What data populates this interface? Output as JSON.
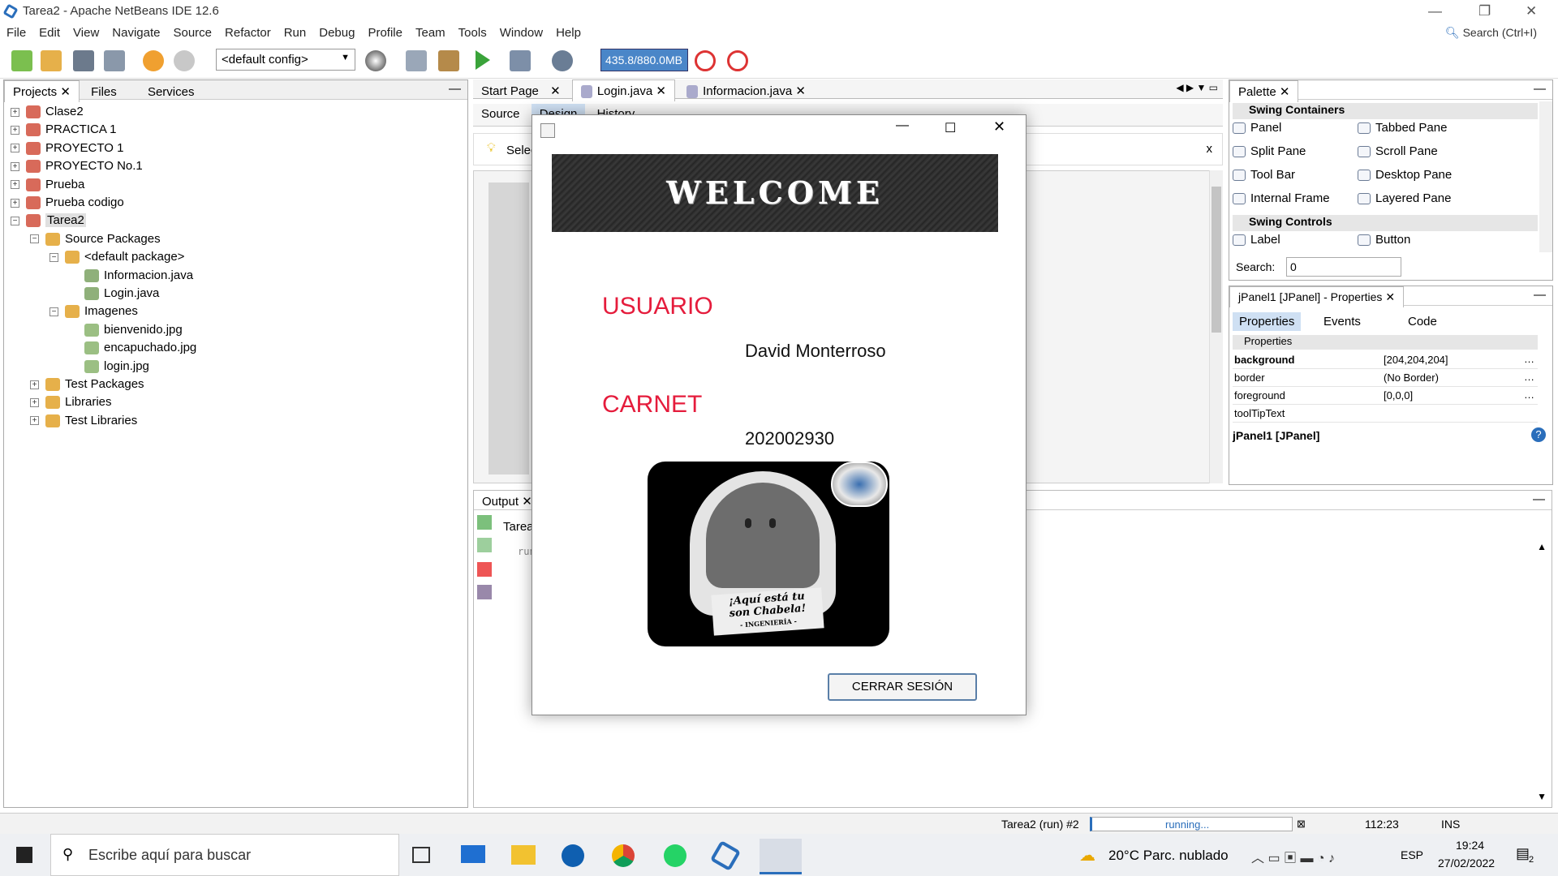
{
  "window": {
    "title": "Tarea2 - Apache NetBeans IDE 12.6",
    "search_placeholder": "Search (Ctrl+I)"
  },
  "menu": [
    "File",
    "Edit",
    "View",
    "Navigate",
    "Source",
    "Refactor",
    "Run",
    "Debug",
    "Profile",
    "Team",
    "Tools",
    "Window",
    "Help"
  ],
  "toolbar": {
    "config": "<default config>",
    "memory": "435.8/880.0MB"
  },
  "left_tabs": [
    "Projects",
    "Files",
    "Services"
  ],
  "tree": [
    {
      "label": "Clase2",
      "depth": 0
    },
    {
      "label": "PRACTICA 1",
      "depth": 0
    },
    {
      "label": "PROYECTO 1",
      "depth": 0
    },
    {
      "label": "PROYECTO No.1",
      "depth": 0
    },
    {
      "label": "Prueba",
      "depth": 0
    },
    {
      "label": "Prueba codigo",
      "depth": 0
    },
    {
      "label": "Tarea2",
      "depth": 0
    },
    {
      "label": "Source Packages",
      "depth": 1
    },
    {
      "label": "<default package>",
      "depth": 2
    },
    {
      "label": "Informacion.java",
      "depth": 3
    },
    {
      "label": "Login.java",
      "depth": 3
    },
    {
      "label": "Imagenes",
      "depth": 2
    },
    {
      "label": "bienvenido.jpg",
      "depth": 3
    },
    {
      "label": "encapuchado.jpg",
      "depth": 3
    },
    {
      "label": "login.jpg",
      "depth": 3
    },
    {
      "label": "Test Packages",
      "depth": 1
    },
    {
      "label": "Libraries",
      "depth": 1
    },
    {
      "label": "Test Libraries",
      "depth": 1
    }
  ],
  "editor_tabs": [
    "Start Page",
    "Login.java",
    "Informacion.java"
  ],
  "editor_subtabs": {
    "source": "Source",
    "design": "Design",
    "history": "History",
    "select": "Selec"
  },
  "output": {
    "tab": "Output",
    "subtab": "Tarea",
    "run_text": "run"
  },
  "dialog": {
    "welcome": "WELCOME",
    "usuario_label": "USUARIO",
    "usuario_value": "David Monterroso",
    "carnet_label": "CARNET",
    "carnet_value": "202002930",
    "badge_text1": "¡Aquí está tu",
    "badge_text2": "son Chabela!",
    "badge_text3": "- INGENIERÍA -",
    "button": "CERRAR SESIÓN"
  },
  "palette": {
    "title": "Palette",
    "section1": "Swing Containers",
    "items1": [
      "Panel",
      "Tabbed Pane",
      "Split Pane",
      "Scroll Pane",
      "Tool Bar",
      "Desktop Pane",
      "Internal Frame",
      "Layered Pane"
    ],
    "section2": "Swing Controls",
    "items2": [
      "Label",
      "Button"
    ],
    "search_label": "Search:",
    "search_value": "0"
  },
  "properties": {
    "title": "jPanel1 [JPanel] - Properties",
    "tabs": [
      "Properties",
      "Events",
      "Code"
    ],
    "section": "Properties",
    "rows": [
      {
        "name": "background",
        "value": "[204,204,204]"
      },
      {
        "name": "border",
        "value": "(No Border)"
      },
      {
        "name": "foreground",
        "value": "[0,0,0]"
      },
      {
        "name": "toolTipText",
        "value": ""
      }
    ],
    "footer": "jPanel1 [JPanel]"
  },
  "status": {
    "run": "Tarea2 (run) #2",
    "progress": "running...",
    "position": "112:23",
    "mode": "INS"
  },
  "taskbar": {
    "search": "Escribe aquí para buscar",
    "weather": "20°C  Parc. nublado",
    "lang": "ESP",
    "time": "19:24",
    "date": "27/02/2022",
    "notifications": "2"
  }
}
